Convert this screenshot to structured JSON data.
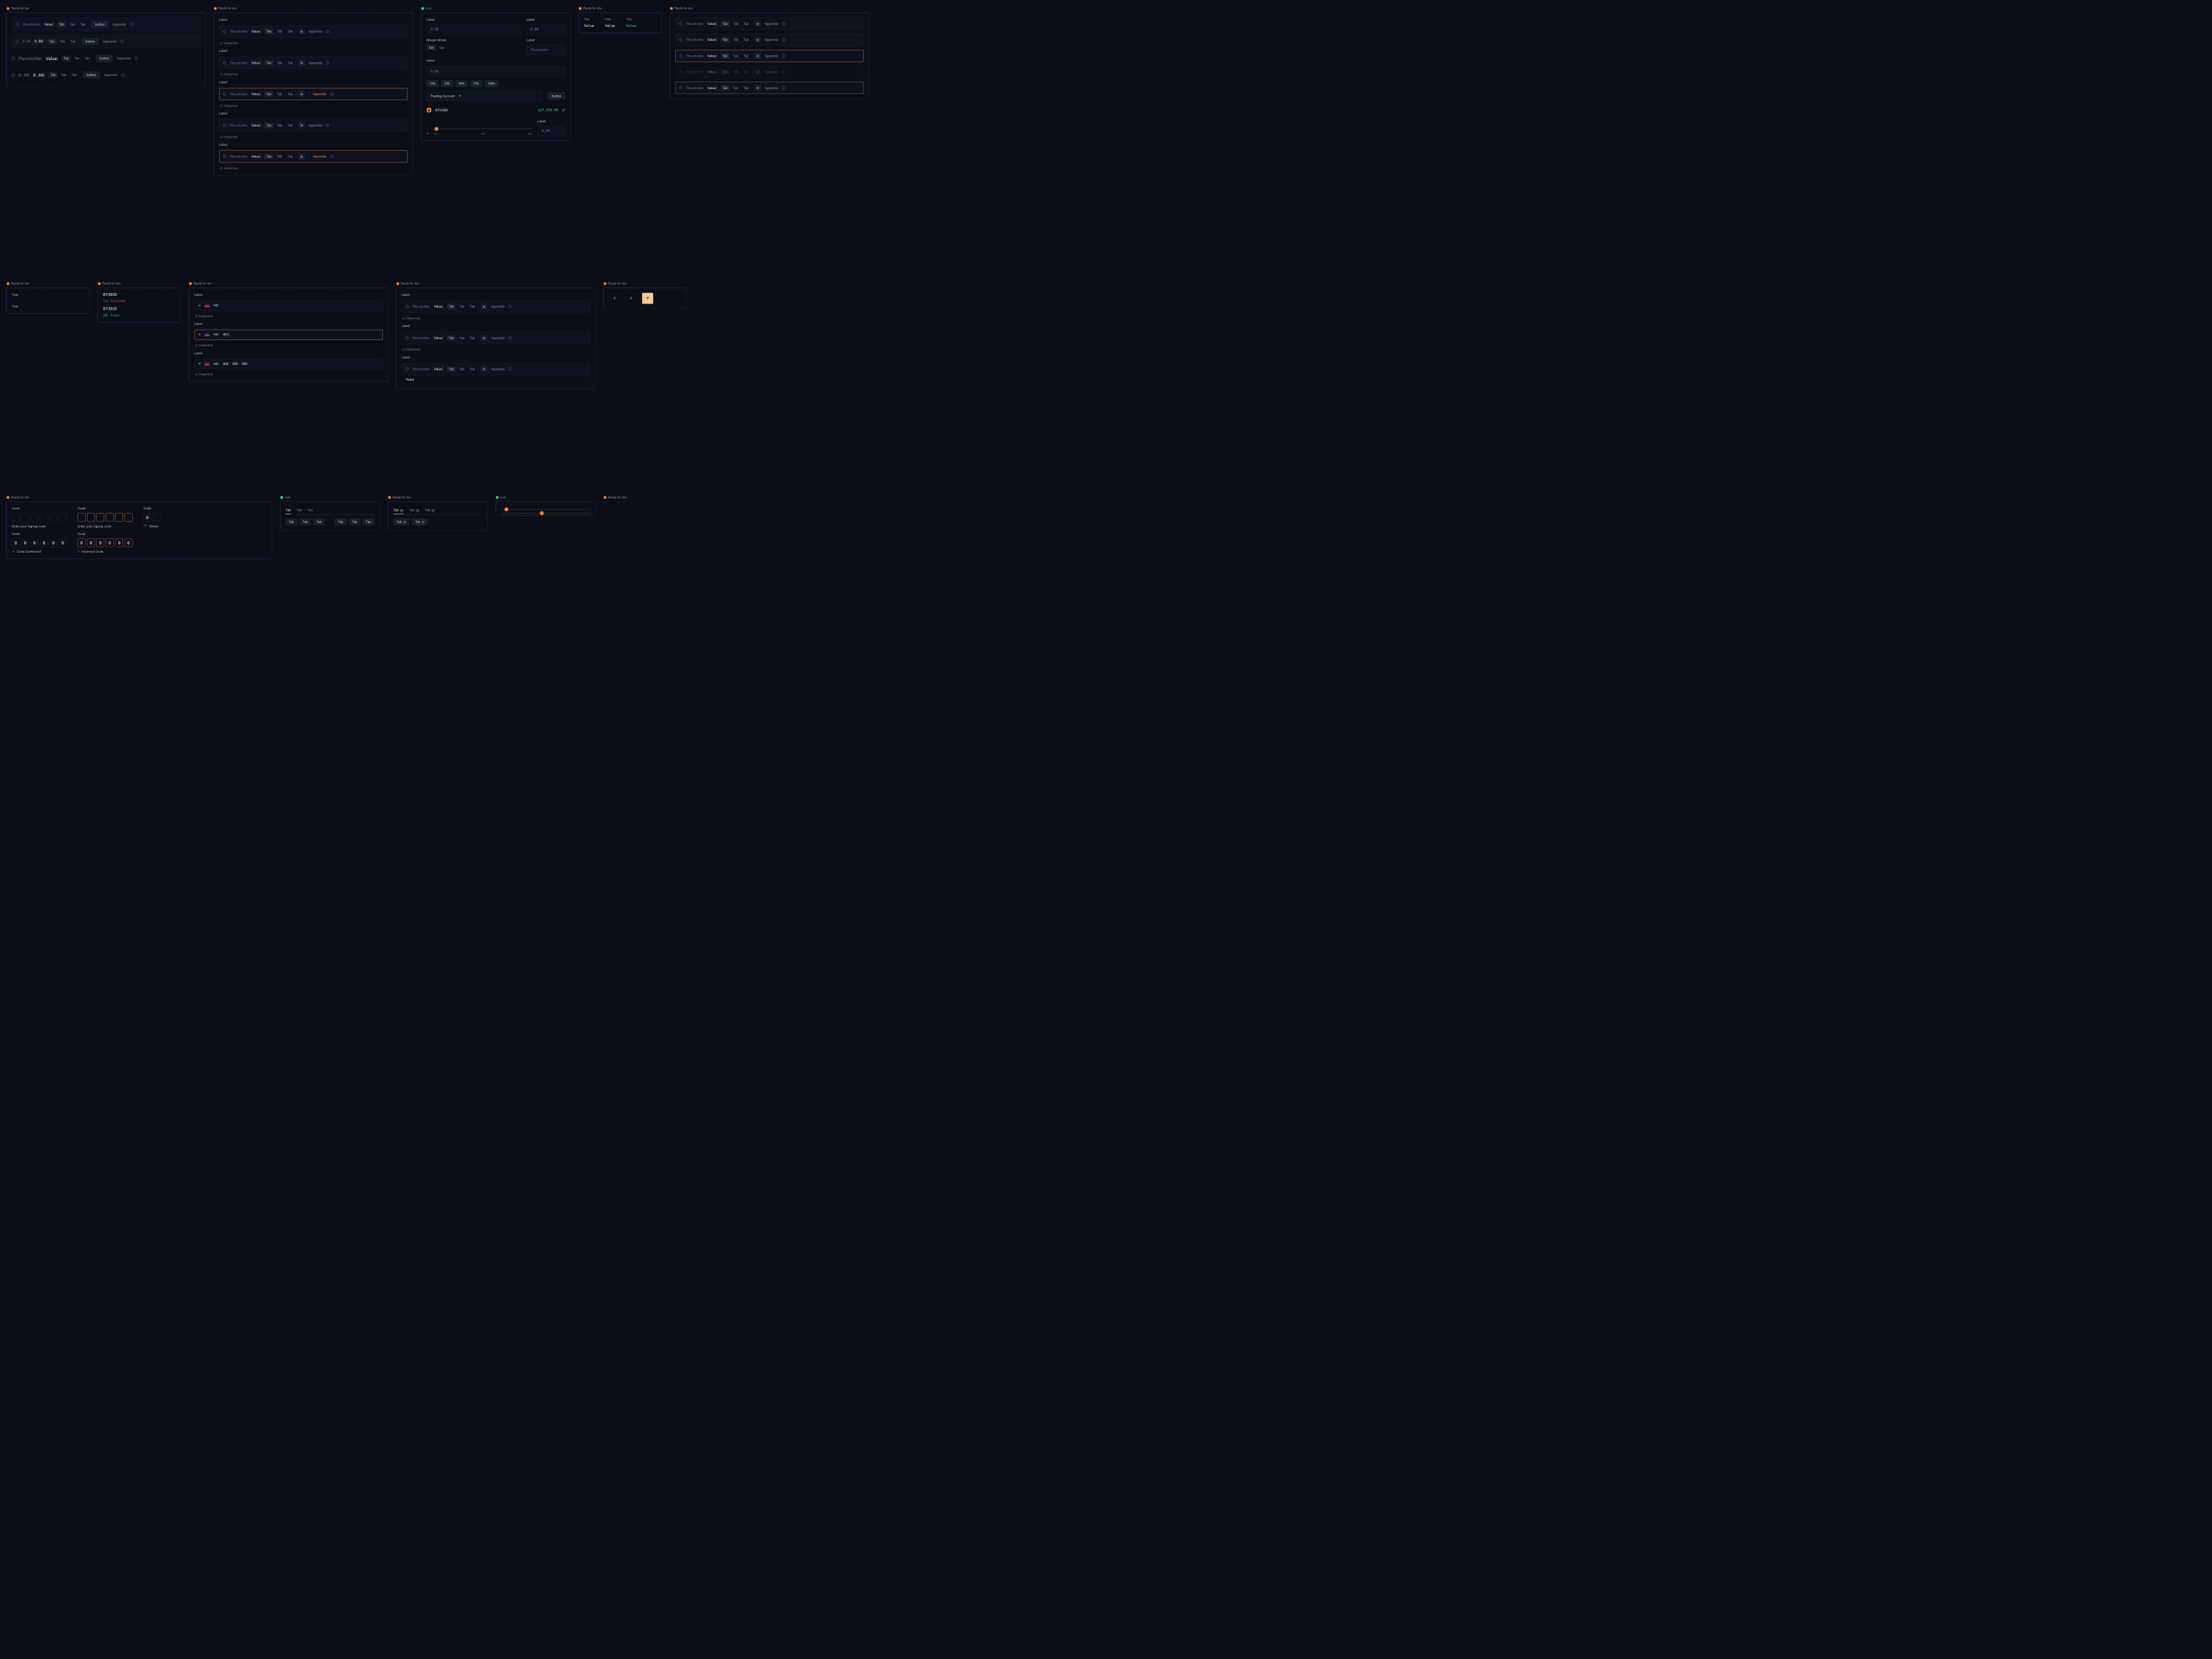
{
  "tags": {
    "ready": "Ready for dev",
    "live": "Live"
  },
  "common": {
    "placeholder": "Placeholder",
    "value": "Value",
    "tab": "Tab",
    "button": "button",
    "appendix": "Appendix",
    "helper": "Helpertext",
    "label": "Label",
    "zero": "0.00",
    "hash": "#",
    "text": "Text"
  },
  "phone": {
    "code": "+61",
    "partial": "401",
    "full_a": "400",
    "full_b": "000",
    "full_c": "000"
  },
  "trade": {
    "margin_label": "Margin Mode:",
    "pct": [
      "10%",
      "25%",
      "50%",
      "75%",
      "100%"
    ],
    "account": "Trading Account",
    "pair": "BTCUSD",
    "price": "$27,554.00",
    "slider": [
      "0%",
      "10x",
      "20x"
    ]
  },
  "titles": {
    "title": "Title"
  },
  "sym": {
    "a_name": "BTCBUSD",
    "a_sub": "12x Isolated",
    "b_name": "BTCBUSD",
    "b_sub": "28x Cross"
  },
  "code": {
    "label": "Code:",
    "hint": "Enter your signup code",
    "zero": "0",
    "confirmed": "Code Confirmed",
    "incorrect": "Incorrect Code",
    "check": "Check"
  },
  "tabcount": [
    "Tab",
    "0"
  ]
}
